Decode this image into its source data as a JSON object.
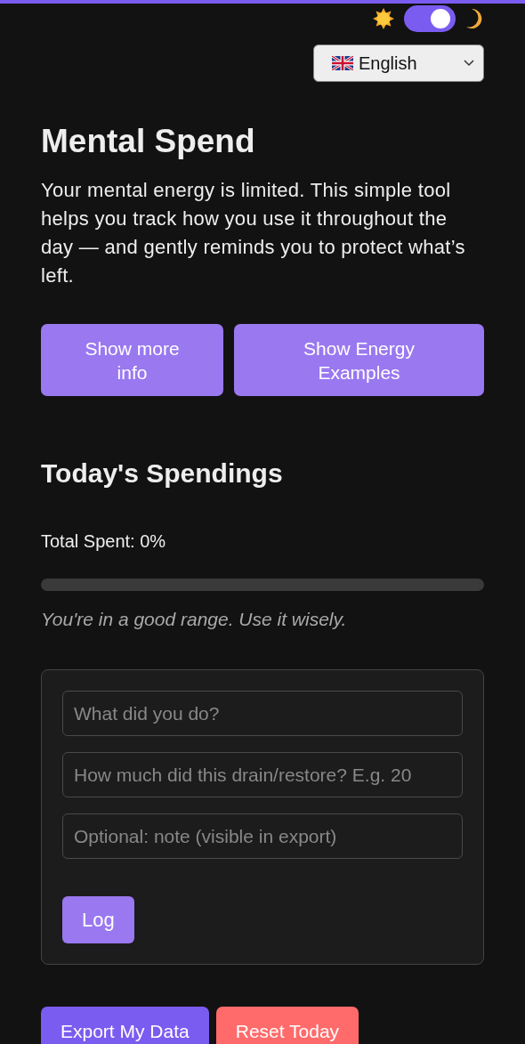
{
  "theme_toggle": {
    "on": true
  },
  "language_select": {
    "value": "English"
  },
  "title": "Mental Spend",
  "intro": "Your mental energy is limited. This simple tool helps you track how you use it throughout the day — and gently reminds you to protect what’s left.",
  "info_buttons": [
    "Show more info",
    "Show Energy Examples"
  ],
  "spendings": {
    "heading": "Today's Spendings",
    "total": "Total Spent: 0%",
    "level": 0,
    "message": "You're in a good range. Use it wisely."
  },
  "form": {
    "fields": [
      {
        "placeholder": "What did you do?"
      },
      {
        "placeholder": "How much did this drain/restore? E.g. 20"
      },
      {
        "placeholder": "Optional: note (visible in export)"
      }
    ],
    "submit": "Log"
  },
  "actions": [
    {
      "label": "Export My Data",
      "kind": "primary"
    },
    {
      "label": "Reset Today",
      "kind": "danger"
    }
  ]
}
